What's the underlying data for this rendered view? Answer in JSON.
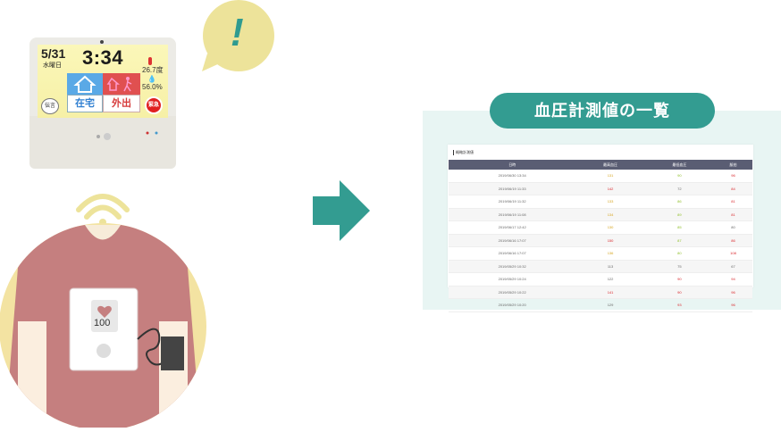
{
  "tablet": {
    "date": "5/31",
    "weekday": "水曜日",
    "time": "3:34",
    "temperature": "26.7度",
    "humidity": "56.0%",
    "home_label": "在宅",
    "out_label": "外出",
    "message_label": "伝言",
    "emergency_label": "緊急"
  },
  "bubble": {
    "mark": "!"
  },
  "device": {
    "reading": "100"
  },
  "panel": {
    "title": "血圧計測値の一覧",
    "sheet_title": "概略計測値",
    "columns": [
      "日時",
      "最高血圧",
      "最低血圧",
      "脈拍"
    ],
    "rows": [
      {
        "date": "2019/06/30 13:34",
        "sys": "131",
        "dia": "90",
        "pulse": "96"
      },
      {
        "date": "2019/06/19 11:33",
        "sys": "142",
        "dia": "72",
        "pulse": "84"
      },
      {
        "date": "2019/06/19 11:32",
        "sys": "133",
        "dia": "86",
        "pulse": "81"
      },
      {
        "date": "2019/06/19 11:08",
        "sys": "134",
        "dia": "89",
        "pulse": "81"
      },
      {
        "date": "2019/06/17 12:42",
        "sys": "130",
        "dia": "85",
        "pulse": "80"
      },
      {
        "date": "2019/06/16 17:07",
        "sys": "150",
        "dia": "87",
        "pulse": "86"
      },
      {
        "date": "2019/06/16 17:07",
        "sys": "136",
        "dia": "80",
        "pulse": "108"
      },
      {
        "date": "2019/05/29 10:32",
        "sys": "113",
        "dia": "75",
        "pulse": "67"
      },
      {
        "date": "2019/05/29 10:24",
        "sys": "122",
        "dia": "90",
        "pulse": "94"
      },
      {
        "date": "2019/05/29 10:22",
        "sys": "141",
        "dia": "90",
        "pulse": "96"
      },
      {
        "date": "2019/05/29 10:20",
        "sys": "129",
        "dia": "93",
        "pulse": "96"
      }
    ],
    "row_colors": [
      {
        "sys": "yellow",
        "dia": "green",
        "pulse": "red"
      },
      {
        "sys": "red",
        "dia": "gray",
        "pulse": "red"
      },
      {
        "sys": "yellow",
        "dia": "green",
        "pulse": "red"
      },
      {
        "sys": "yellow",
        "dia": "green",
        "pulse": "red"
      },
      {
        "sys": "yellow",
        "dia": "green",
        "pulse": "gray"
      },
      {
        "sys": "red",
        "dia": "green",
        "pulse": "red"
      },
      {
        "sys": "yellow",
        "dia": "green",
        "pulse": "red"
      },
      {
        "sys": "gray",
        "dia": "gray",
        "pulse": "gray"
      },
      {
        "sys": "gray",
        "dia": "red",
        "pulse": "red"
      },
      {
        "sys": "red",
        "dia": "red",
        "pulse": "red"
      },
      {
        "sys": "gray",
        "dia": "red",
        "pulse": "red"
      }
    ]
  },
  "colors": {
    "teal": "#339c91",
    "panel_bg": "#e8f5f3",
    "bubble": "#ede39a",
    "shirt": "#c57f7f",
    "cream": "#f4e6a0"
  }
}
